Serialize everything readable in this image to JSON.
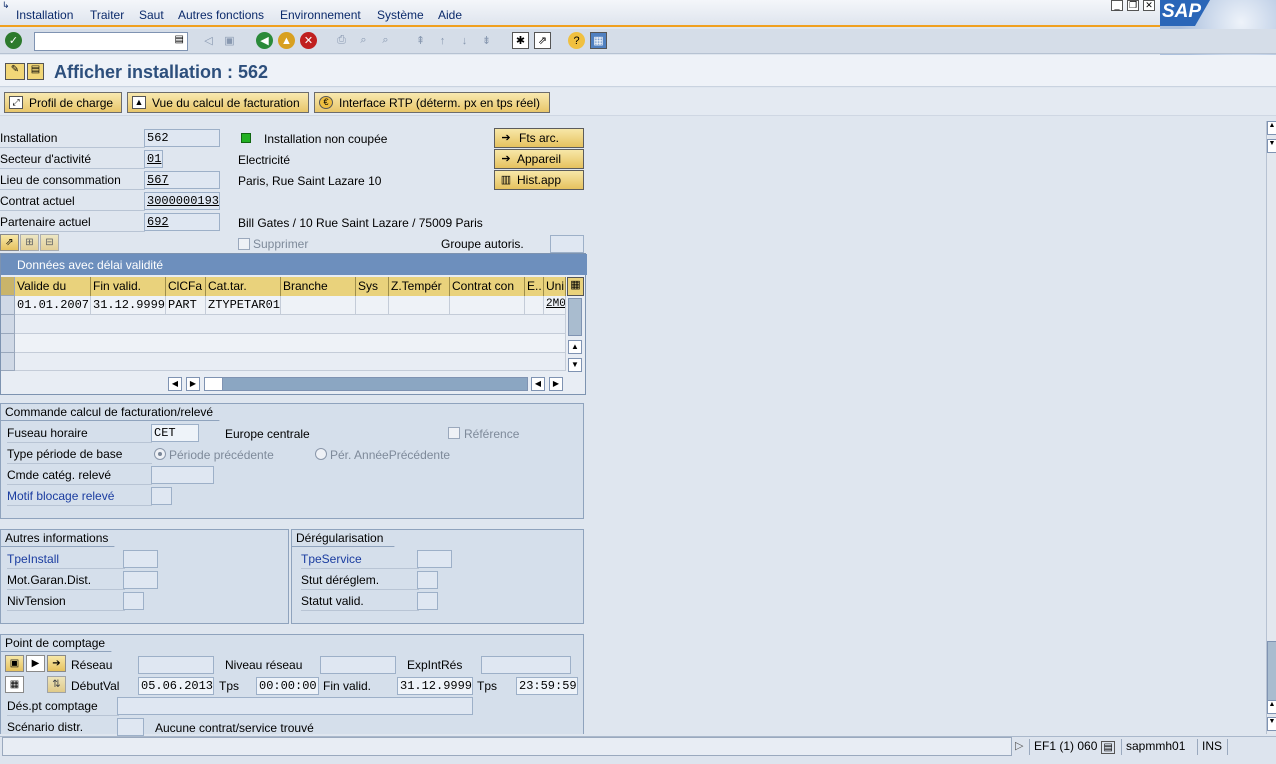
{
  "menu": [
    "Installation",
    "Traiter",
    "Saut",
    "Autres fonctions",
    "Environnement",
    "Système",
    "Aide"
  ],
  "logo_text": "SAP",
  "title": "Afficher installation : 562",
  "app_buttons": [
    "Profil de charge",
    "Vue du calcul de facturation",
    "Interface RTP (déterm. px en tps réel)"
  ],
  "header": {
    "installation": {
      "label": "Installation",
      "value": "562"
    },
    "secteur": {
      "label": "Secteur d'activité",
      "value": "01",
      "desc": "Electricité"
    },
    "lieu": {
      "label": "Lieu de consommation",
      "value": "567",
      "desc": "Paris, Rue Saint Lazare  10"
    },
    "contrat": {
      "label": "Contrat actuel",
      "value": "3000000193"
    },
    "partenaire": {
      "label": "Partenaire actuel",
      "value": "692",
      "desc": "Bill Gates / 10 Rue Saint Lazare / 75009 Paris"
    },
    "status_text": "Installation non coupée",
    "status_color": "#22b022",
    "side_buttons": [
      "Fts arc.",
      "Appareil",
      "Hist.app"
    ],
    "supprimer": "Supprimer",
    "groupe_label": "Groupe autoris."
  },
  "table": {
    "title": "Données avec délai validité",
    "columns": [
      "Valide du",
      "Fin valid.",
      "ClCFa",
      "Cat.tar.",
      "Branche",
      "Sys",
      "Z.Tempér",
      "Contrat con",
      "E..",
      "Uni"
    ],
    "rows": [
      [
        "01.01.2007",
        "31.12.9999",
        "PART",
        "ZTYPETAR01",
        "",
        "",
        "",
        "",
        "",
        "2M0"
      ]
    ]
  },
  "commande": {
    "title": "Commande calcul de facturation/relevé",
    "fuseau_label": "Fuseau horaire",
    "fuseau_value": "CET",
    "fuseau_desc": "Europe centrale",
    "reference": "Référence",
    "type_label": "Type période de base",
    "radio1": "Période précédente",
    "radio2": "Pér. AnnéePrécédente",
    "cmde_label": "Cmde catég. relevé",
    "motif_label": "Motif blocage relevé"
  },
  "autres": {
    "title": "Autres informations",
    "rows": [
      "TpeInstall",
      "Mot.Garan.Dist.",
      "NivTension"
    ]
  },
  "dereg": {
    "title": "Dérégularisation",
    "rows": [
      "TpeService",
      "Stut déréglem.",
      "Statut valid."
    ]
  },
  "comptage": {
    "title": "Point de comptage",
    "reseau": "Réseau",
    "niveau": "Niveau réseau",
    "expint": "ExpIntRés",
    "debut_label": "DébutVal",
    "debut_value": "05.06.2013",
    "tps1_label": "Tps",
    "tps1_value": "00:00:00",
    "fin_label": "Fin valid.",
    "fin_value": "31.12.9999",
    "tps2_label": "Tps",
    "tps2_value": "23:59:59",
    "des_label": "Dés.pt comptage",
    "scenario_label": "Scénario distr.",
    "scenario_desc": "Aucune contrat/service trouvé"
  },
  "status": {
    "system": "EF1 (1) 060",
    "server": "sapmmh01",
    "mode": "INS"
  }
}
